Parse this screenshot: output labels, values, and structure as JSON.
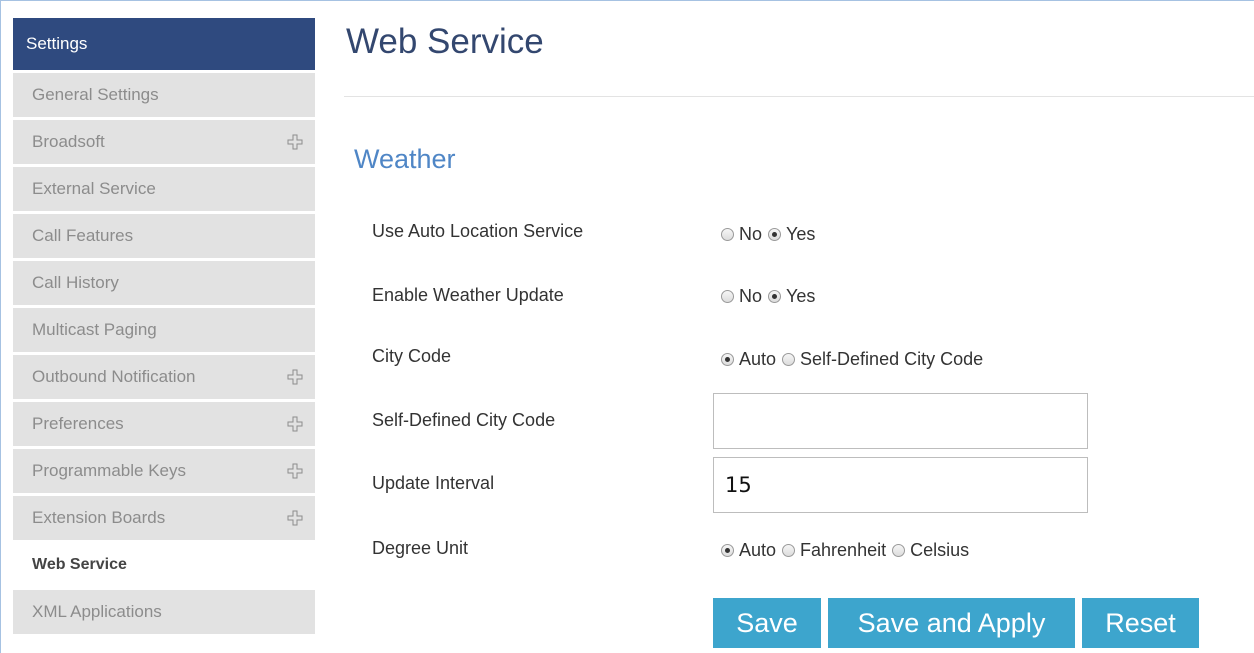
{
  "sidebar": {
    "header": "Settings",
    "items": [
      {
        "label": "General Settings",
        "expandable": false,
        "active": false
      },
      {
        "label": "Broadsoft",
        "expandable": true,
        "active": false
      },
      {
        "label": "External Service",
        "expandable": false,
        "active": false
      },
      {
        "label": "Call Features",
        "expandable": false,
        "active": false
      },
      {
        "label": "Call History",
        "expandable": false,
        "active": false
      },
      {
        "label": "Multicast Paging",
        "expandable": false,
        "active": false
      },
      {
        "label": "Outbound Notification",
        "expandable": true,
        "active": false
      },
      {
        "label": "Preferences",
        "expandable": true,
        "active": false
      },
      {
        "label": "Programmable Keys",
        "expandable": true,
        "active": false
      },
      {
        "label": "Extension Boards",
        "expandable": true,
        "active": false
      },
      {
        "label": "Web Service",
        "expandable": false,
        "active": true
      },
      {
        "label": "XML Applications",
        "expandable": false,
        "active": false
      }
    ],
    "expand_icon": "plus-icon"
  },
  "main": {
    "title": "Web Service",
    "section_title": "Weather",
    "fields": {
      "auto_location": {
        "label": "Use Auto Location Service",
        "options": [
          "No",
          "Yes"
        ],
        "selected": "Yes"
      },
      "weather_update": {
        "label": "Enable Weather Update",
        "options": [
          "No",
          "Yes"
        ],
        "selected": "Yes"
      },
      "city_code": {
        "label": "City Code",
        "options": [
          "Auto",
          "Self-Defined City Code"
        ],
        "selected": "Auto"
      },
      "self_defined_city_code": {
        "label": "Self-Defined City Code",
        "value": ""
      },
      "update_interval": {
        "label": "Update Interval",
        "value": "15"
      },
      "degree_unit": {
        "label": "Degree Unit",
        "options": [
          "Auto",
          "Fahrenheit",
          "Celsius"
        ],
        "selected": "Auto"
      }
    },
    "buttons": {
      "save": "Save",
      "save_apply": "Save and Apply",
      "reset": "Reset"
    }
  },
  "colors": {
    "sidebar_header": "#2f4a7f",
    "sidebar_item_bg": "#e2e2e2",
    "title": "#33476f",
    "section_title": "#4f86c6",
    "button": "#3da5cd"
  }
}
